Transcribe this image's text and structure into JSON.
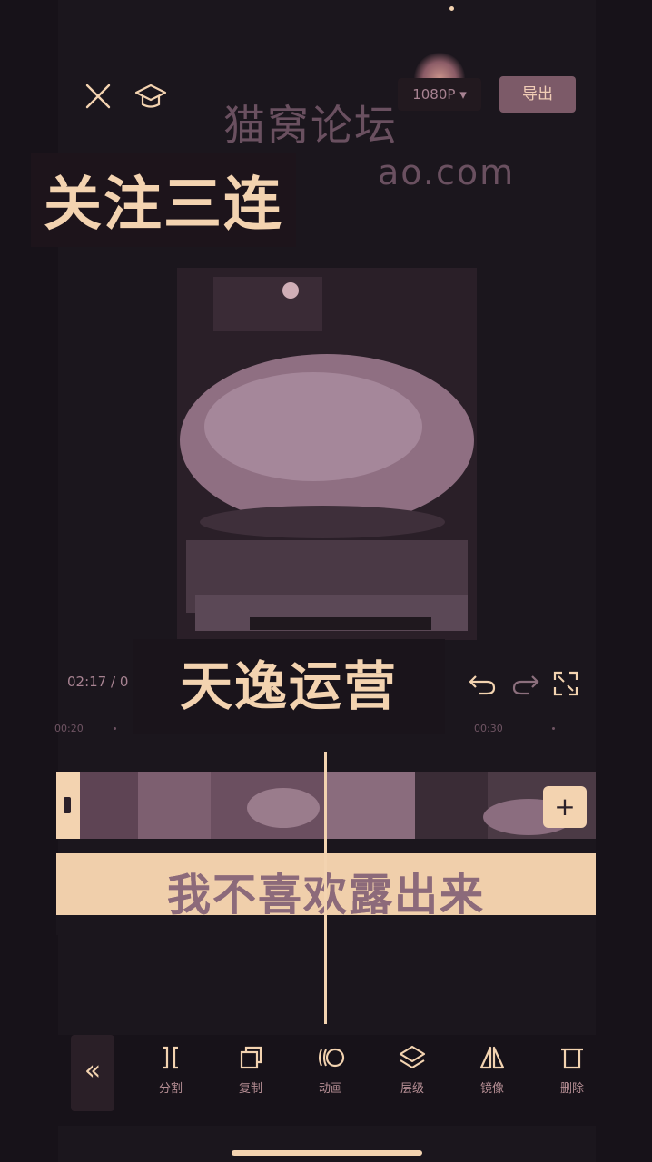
{
  "top_bar": {
    "close_icon": "close-icon",
    "tutorial_icon": "graduation-cap-icon",
    "resolution_label": "1080P",
    "export_label": "导出"
  },
  "overlays": {
    "watermark_cn": "猫窝论坛",
    "watermark_url": "ao.com",
    "sticker_follow": "关注三连",
    "sticker_tianyi": "天逸运营",
    "subtitle": "我不喜欢露出来"
  },
  "playback": {
    "time_readout": "02:17 / 0",
    "ruler_ticks": [
      "00:20",
      "00:30"
    ]
  },
  "toolbar": {
    "collapse_glyph": "«",
    "items": [
      {
        "icon": "split-icon",
        "label": "分割"
      },
      {
        "icon": "copy-icon",
        "label": "复制"
      },
      {
        "icon": "animation-icon",
        "label": "动画"
      },
      {
        "icon": "layers-icon",
        "label": "层级"
      },
      {
        "icon": "mirror-icon",
        "label": "镜像"
      },
      {
        "icon": "delete-icon",
        "label": "删除"
      }
    ]
  },
  "colors": {
    "background": "#171219",
    "accent": "#f3d3b0",
    "muted": "#a88392",
    "export_button": "#7c5a68"
  }
}
